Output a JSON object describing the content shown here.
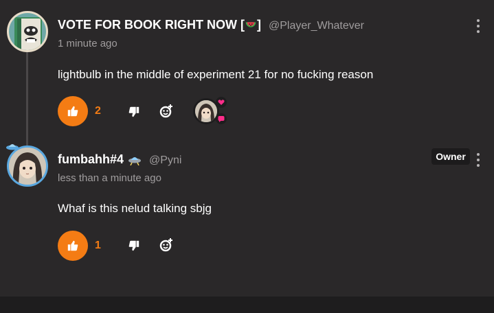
{
  "comments": [
    {
      "username_prefix": "VOTE FOR BOOK RIGHT NOW [",
      "username_suffix": "]",
      "emoji": "watermelon",
      "handle": "@Player_Whatever",
      "time": "1 minute ago",
      "text": "lightbulb in the middle of experiment 21 for no fucking reason",
      "likes": "2",
      "avatar": "book-character-avatar"
    },
    {
      "username": "fumbahh#4",
      "handle": "@Pyni",
      "badge": "Owner",
      "time": "less than a minute ago",
      "text": "Whaf is this nelud talking sbjg",
      "likes": "1",
      "avatar": "anime-character-avatar"
    }
  ],
  "colors": {
    "background": "#2a2829",
    "accent": "#f47c14",
    "muted_text": "#a09d9e",
    "reaction_heart": "#ff2d8a"
  },
  "icons": [
    "thumbs-up-icon",
    "thumbs-down-icon",
    "add-reaction-icon",
    "more-vertical-icon",
    "ufo-icon",
    "heart-icon",
    "chat-bubble-icon"
  ]
}
